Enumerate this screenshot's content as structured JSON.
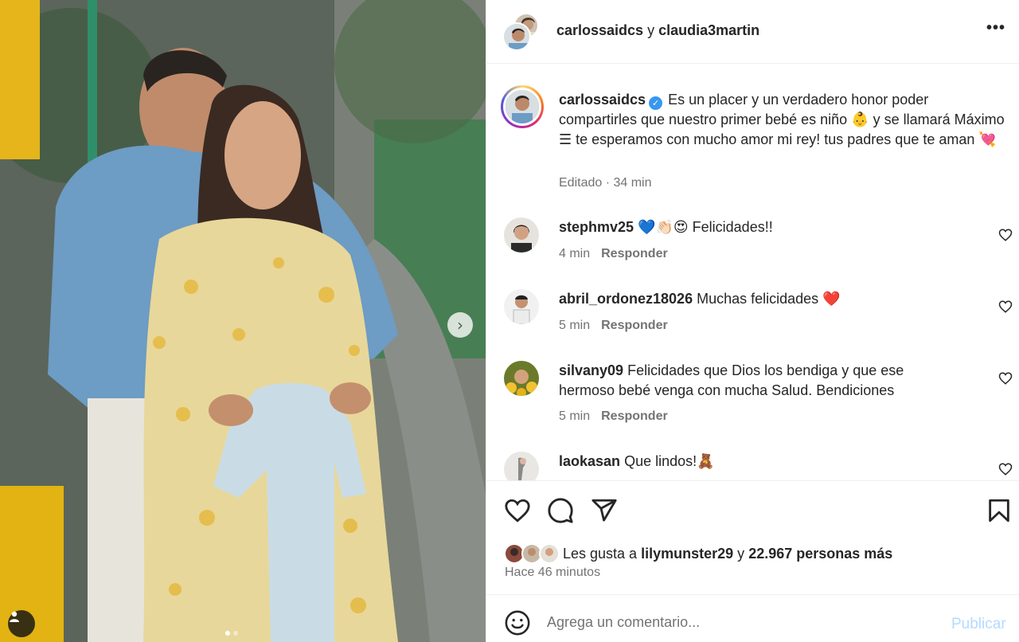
{
  "post": {
    "media_alt": "Couple photo",
    "next_arrow": "›",
    "dots": [
      true,
      false
    ]
  },
  "header": {
    "user1": "carlossaidcs",
    "joiner": "y",
    "user2": "claudia3martin",
    "more": "•••"
  },
  "caption": {
    "username": "carlossaidcs",
    "verified_glyph": "✓",
    "text": "Es un placer y un verdadero honor poder compartirles que nuestro primer bebé es niño 👶 y se llamará Máximo ☰ te esperamos con mucho amor mi rey! tus padres que te aman 💘",
    "meta": "Editado · 34 min"
  },
  "comments": [
    {
      "username": "stephmv25",
      "text": "💙👏🏻😍 Felicidades!!",
      "time": "4 min",
      "reply": "Responder"
    },
    {
      "username": "abril_ordonez18026",
      "text": "Muchas felicidades ❤️",
      "time": "5 min",
      "reply": "Responder"
    },
    {
      "username": "silvany09",
      "text": "Felicidades que Dios los bendiga y que ese hermoso bebé venga con mucha Salud. Bendiciones",
      "time": "5 min",
      "reply": "Responder"
    },
    {
      "username": "laokasan",
      "text": "Que lindos!🧸",
      "time": "",
      "reply": ""
    }
  ],
  "likes": {
    "prefix": "Les gusta a",
    "user": "lilymunster29",
    "joiner": "y",
    "count": "22.967 personas más",
    "time_ago": "Hace 46 minutos"
  },
  "add_comment": {
    "placeholder": "Agrega un comentario...",
    "publish": "Publicar"
  },
  "colors": {
    "text": "#262626",
    "secondary": "#737373",
    "publish_disabled": "#b3dbff",
    "verified": "#3897f0",
    "divider": "#efefef"
  },
  "icons": [
    "heart-icon",
    "comment-icon",
    "share-icon",
    "bookmark-icon",
    "emoji-icon",
    "more-icon",
    "user-tag-icon",
    "chevron-right-icon"
  ]
}
